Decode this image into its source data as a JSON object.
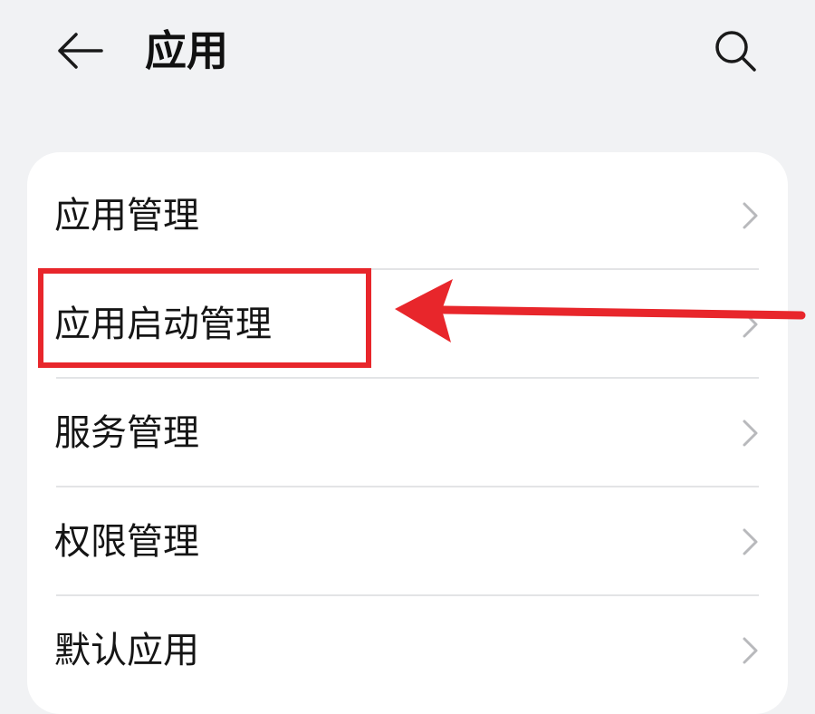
{
  "header": {
    "title": "应用",
    "back_icon": "back-arrow-icon",
    "search_icon": "search-icon"
  },
  "settings_list": {
    "items": [
      {
        "label": "应用管理"
      },
      {
        "label": "应用启动管理"
      },
      {
        "label": "服务管理"
      },
      {
        "label": "权限管理"
      },
      {
        "label": "默认应用"
      }
    ]
  },
  "annotation": {
    "color": "#e8262b",
    "highlighted_item": "应用启动管理"
  },
  "colors": {
    "background": "#f1f2f4",
    "card": "#ffffff",
    "divider": "#e3e4e6",
    "chevron": "#b8b9bc"
  }
}
